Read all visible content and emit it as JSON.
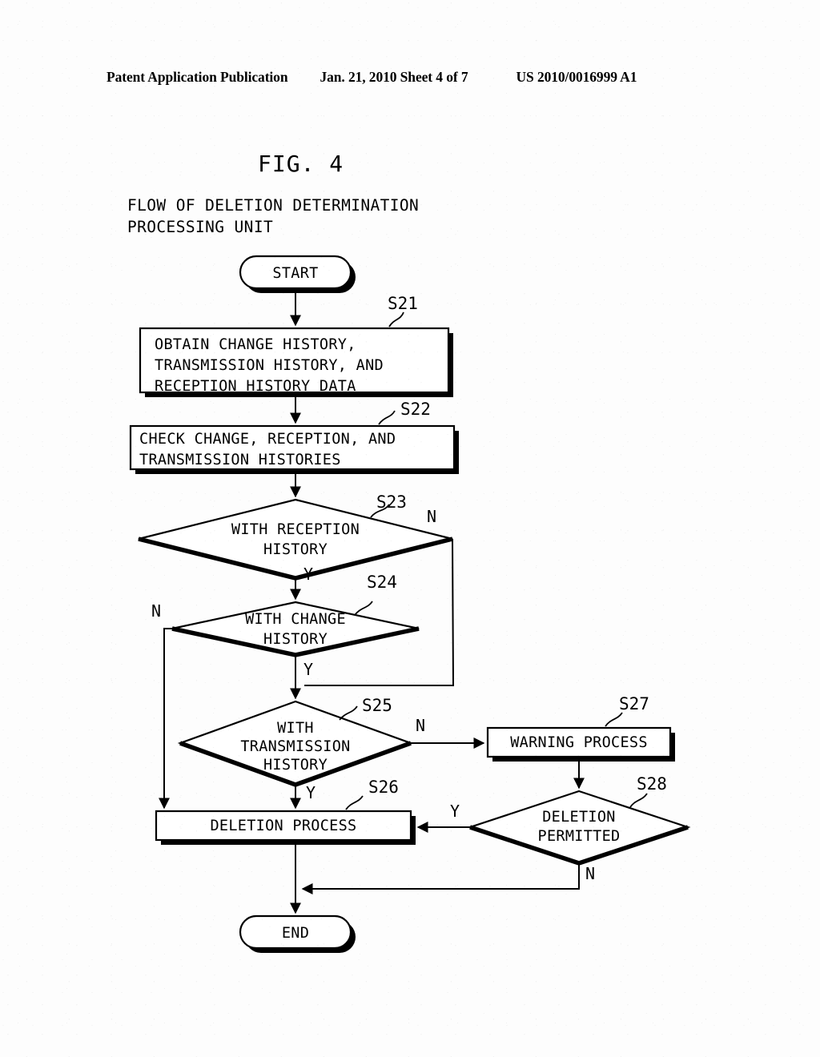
{
  "header": {
    "publication": "Patent Application Publication",
    "date_sheet": "Jan. 21, 2010  Sheet 4 of 7",
    "patent_number": "US 2010/0016999 A1"
  },
  "figure": {
    "label": "FIG. 4",
    "caption": "FLOW OF DELETION DETERMINATION\nPROCESSING UNIT"
  },
  "flowchart": {
    "type": "flowchart",
    "nodes": [
      {
        "id": "start",
        "shape": "terminal",
        "text": "START",
        "step": null
      },
      {
        "id": "s21",
        "shape": "process",
        "text": "OBTAIN CHANGE HISTORY,\nTRANSMISSION HISTORY, AND\nRECEPTION HISTORY DATA",
        "step": "S21"
      },
      {
        "id": "s22",
        "shape": "process",
        "text": "CHECK CHANGE, RECEPTION, AND\nTRANSMISSION HISTORIES",
        "step": "S22"
      },
      {
        "id": "s23",
        "shape": "decision",
        "text": "WITH RECEPTION\nHISTORY",
        "step": "S23"
      },
      {
        "id": "s24",
        "shape": "decision",
        "text": "WITH CHANGE\nHISTORY",
        "step": "S24"
      },
      {
        "id": "s25",
        "shape": "decision",
        "text": "WITH\nTRANSMISSION\nHISTORY",
        "step": "S25"
      },
      {
        "id": "s26",
        "shape": "process",
        "text": "DELETION PROCESS",
        "step": "S26"
      },
      {
        "id": "s27",
        "shape": "process",
        "text": "WARNING PROCESS",
        "step": "S27"
      },
      {
        "id": "s28",
        "shape": "decision",
        "text": "DELETION\nPERMITTED",
        "step": "S28"
      },
      {
        "id": "end",
        "shape": "terminal",
        "text": "END",
        "step": null
      }
    ],
    "node_lines": {
      "start": "START",
      "end": "END",
      "s21_l1": "OBTAIN CHANGE HISTORY,",
      "s21_l2": "TRANSMISSION HISTORY, AND",
      "s21_l3": "RECEPTION HISTORY DATA",
      "s22_l1": "CHECK CHANGE, RECEPTION, AND",
      "s22_l2": "TRANSMISSION HISTORIES",
      "s23_l1": "WITH RECEPTION",
      "s23_l2": "HISTORY",
      "s24_l1": "WITH CHANGE",
      "s24_l2": "HISTORY",
      "s25_l1": "WITH",
      "s25_l2": "TRANSMISSION",
      "s25_l3": "HISTORY",
      "s26_l1": "DELETION PROCESS",
      "s27_l1": "WARNING PROCESS",
      "s28_l1": "DELETION",
      "s28_l2": "PERMITTED"
    },
    "steps": {
      "s21": "S21",
      "s22": "S22",
      "s23": "S23",
      "s24": "S24",
      "s25": "S25",
      "s26": "S26",
      "s27": "S27",
      "s28": "S28"
    },
    "branches": {
      "s23_n": "N",
      "s23_y": "Y",
      "s24_n": "N",
      "s24_y": "Y",
      "s25_n": "N",
      "s25_y": "Y",
      "s28_y": "Y",
      "s28_n": "N"
    },
    "edges": [
      {
        "from": "start",
        "to": "s21",
        "label": ""
      },
      {
        "from": "s21",
        "to": "s22",
        "label": ""
      },
      {
        "from": "s22",
        "to": "s23",
        "label": ""
      },
      {
        "from": "s23",
        "to": "s24",
        "label": "Y"
      },
      {
        "from": "s23",
        "to": "s25",
        "label": "N"
      },
      {
        "from": "s24",
        "to": "s25",
        "label": "Y"
      },
      {
        "from": "s24",
        "to": "s26",
        "label": "N"
      },
      {
        "from": "s25",
        "to": "s26",
        "label": "Y"
      },
      {
        "from": "s25",
        "to": "s27",
        "label": "N"
      },
      {
        "from": "s27",
        "to": "s28",
        "label": ""
      },
      {
        "from": "s28",
        "to": "s26",
        "label": "Y"
      },
      {
        "from": "s28",
        "to": "end",
        "label": "N"
      },
      {
        "from": "s26",
        "to": "end",
        "label": ""
      }
    ]
  },
  "colors": {
    "ink": "#000000",
    "paper": "#fdfdfd"
  }
}
